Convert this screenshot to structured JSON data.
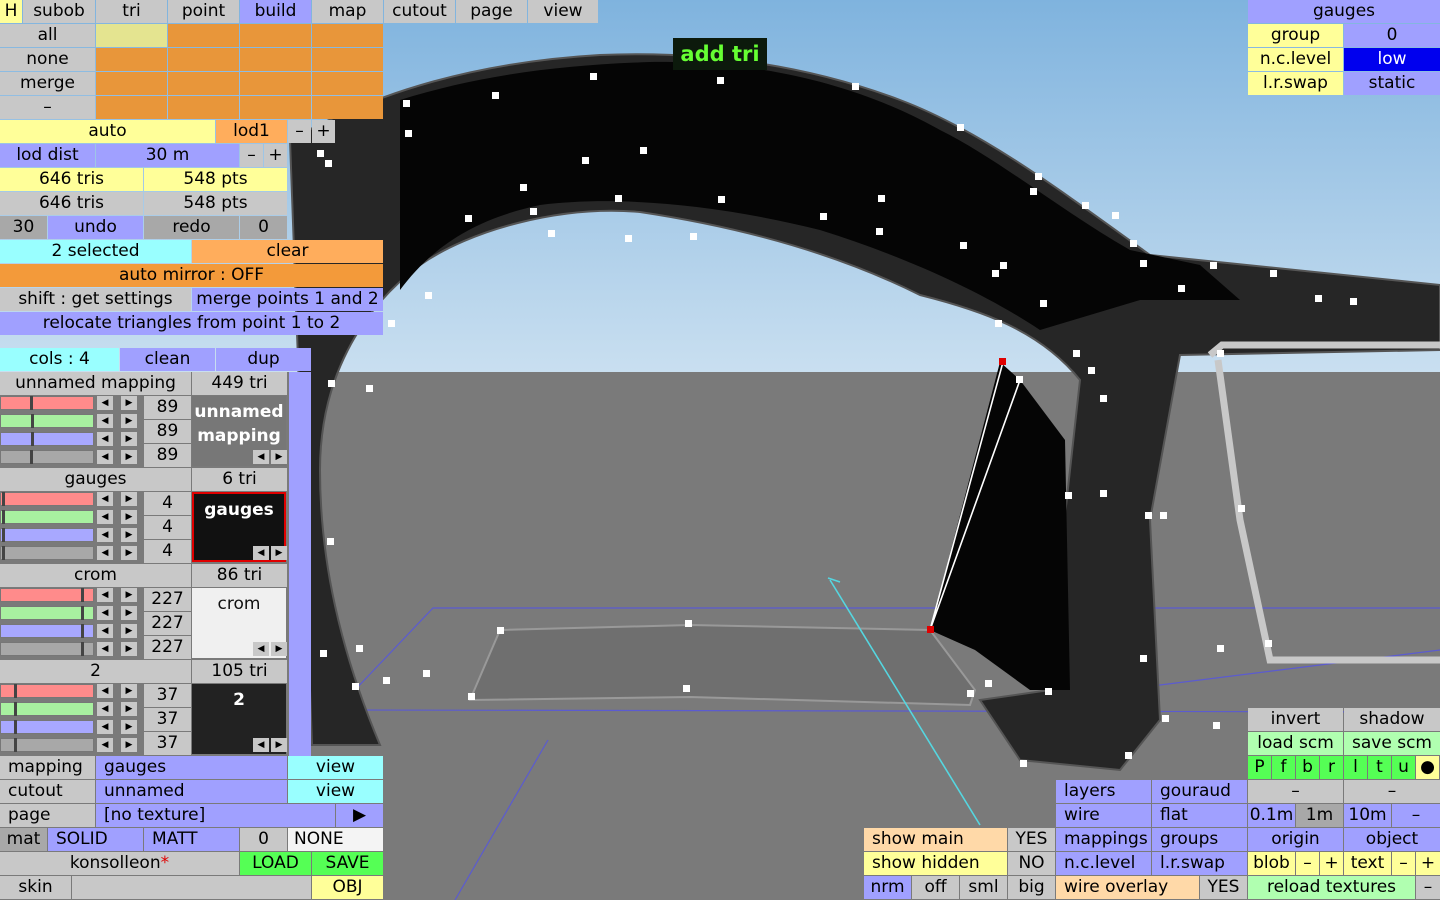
{
  "top_menu": [
    "H",
    "subob",
    "tri",
    "point",
    "build",
    "map",
    "cutout",
    "page",
    "view"
  ],
  "sel": {
    "all": "all",
    "none": "none",
    "merge": "merge",
    "dash": "–"
  },
  "lod": {
    "auto": "auto",
    "lod1": "lod1",
    "minus": "–",
    "plus": "+",
    "dist_label": "lod dist",
    "dist_value": "30 m"
  },
  "stats": {
    "tris1": "646 tris",
    "pts1": "548 pts",
    "tris2": "646 tris",
    "pts2": "548 pts"
  },
  "undo": {
    "count": "30",
    "undo": "undo",
    "redo": "redo",
    "redo_count": "0"
  },
  "selection": {
    "selected": "2 selected",
    "clear": "clear",
    "auto_mirror": "auto mirror : OFF",
    "shift": "shift : get settings",
    "merge": "merge points 1 and 2",
    "relocate": "relocate triangles from point 1 to 2"
  },
  "mapping_panel": {
    "cols": "cols : 4",
    "clean": "clean",
    "dup": "dup",
    "mappings": [
      {
        "name": "unnamed mapping",
        "tris": "449 tri",
        "vals": [
          "89",
          "89",
          "89"
        ],
        "preview": "unnamed\nmapping",
        "slider": [
          0.33,
          0.35,
          0.35,
          0.33
        ]
      },
      {
        "name": "gauges",
        "tris": "6 tri",
        "vals": [
          "4",
          "4",
          "4"
        ],
        "preview": "gauges",
        "slider": [
          0.02,
          0.02,
          0.02,
          0.02
        ]
      },
      {
        "name": "crom",
        "tris": "86 tri",
        "vals": [
          "227",
          "227",
          "227"
        ],
        "preview": "crom",
        "slider": [
          0.9,
          0.9,
          0.9,
          0.9
        ]
      },
      {
        "name": "2",
        "tris": "105 tri",
        "vals": [
          "37",
          "37",
          "37"
        ],
        "preview": "2",
        "slider": [
          0.15,
          0.15,
          0.15,
          0.15
        ]
      }
    ]
  },
  "bottom_left": {
    "mapping_label": "mapping",
    "mapping_value": "gauges",
    "view1": "view",
    "cutout_label": "cutout",
    "cutout_value": "unnamed",
    "view2": "view",
    "page_label": "page",
    "page_value": "[no texture]",
    "page_arrow": "▶",
    "mat": "mat",
    "solid": "SOLID",
    "matt": "MATT",
    "zero": "0",
    "none": "NONE",
    "file": "konsolleon",
    "asterisk": "*",
    "load": "LOAD",
    "save": "SAVE",
    "skin": "skin",
    "obj": "OBJ"
  },
  "top_right": {
    "title": "gauges",
    "group": "group",
    "group_val": "0",
    "nc": "n.c.level",
    "nc_val": "low",
    "lr": "l.r.swap",
    "lr_val": "static"
  },
  "viewport": {
    "tool_label": "add tri"
  },
  "bottom_center": {
    "show_main": "show main",
    "yes1": "YES",
    "show_hidden": "show hidden",
    "no": "NO",
    "nrm": "nrm",
    "off": "off",
    "sml": "sml",
    "big": "big"
  },
  "bottom_right": {
    "invert": "invert",
    "shadow": "shadow",
    "load_scm": "load scm",
    "save_scm": "save scm",
    "flags": [
      "P",
      "f",
      "b",
      "r",
      "l",
      "t",
      "u",
      "●"
    ],
    "dash1": "–",
    "dash2": "–",
    "m01": "0.1m",
    "m1": "1m",
    "m10": "10m",
    "mdash": "–",
    "origin": "origin",
    "object": "object",
    "blob": "blob",
    "bminus": "–",
    "bplus": "+",
    "text": "text",
    "tminus": "–",
    "tplus": "+",
    "reload": "reload textures",
    "rdash": "–",
    "layers": "layers",
    "gouraud": "gouraud",
    "wire": "wire",
    "flat": "flat",
    "mappings": "mappings",
    "groups": "groups",
    "nclevel": "n.c.level",
    "lrswap": "l.r.swap",
    "wire_overlay": "wire overlay",
    "yes": "YES"
  },
  "colors": {
    "sky": "#aecfe8",
    "floor": "#7a7a7a",
    "blue_btn": "#a0a0ff",
    "yellow_btn": "#ffff99",
    "orange_btn": "#ffad5c",
    "cyan_btn": "#99ffff",
    "green_btn": "#55ff55"
  }
}
